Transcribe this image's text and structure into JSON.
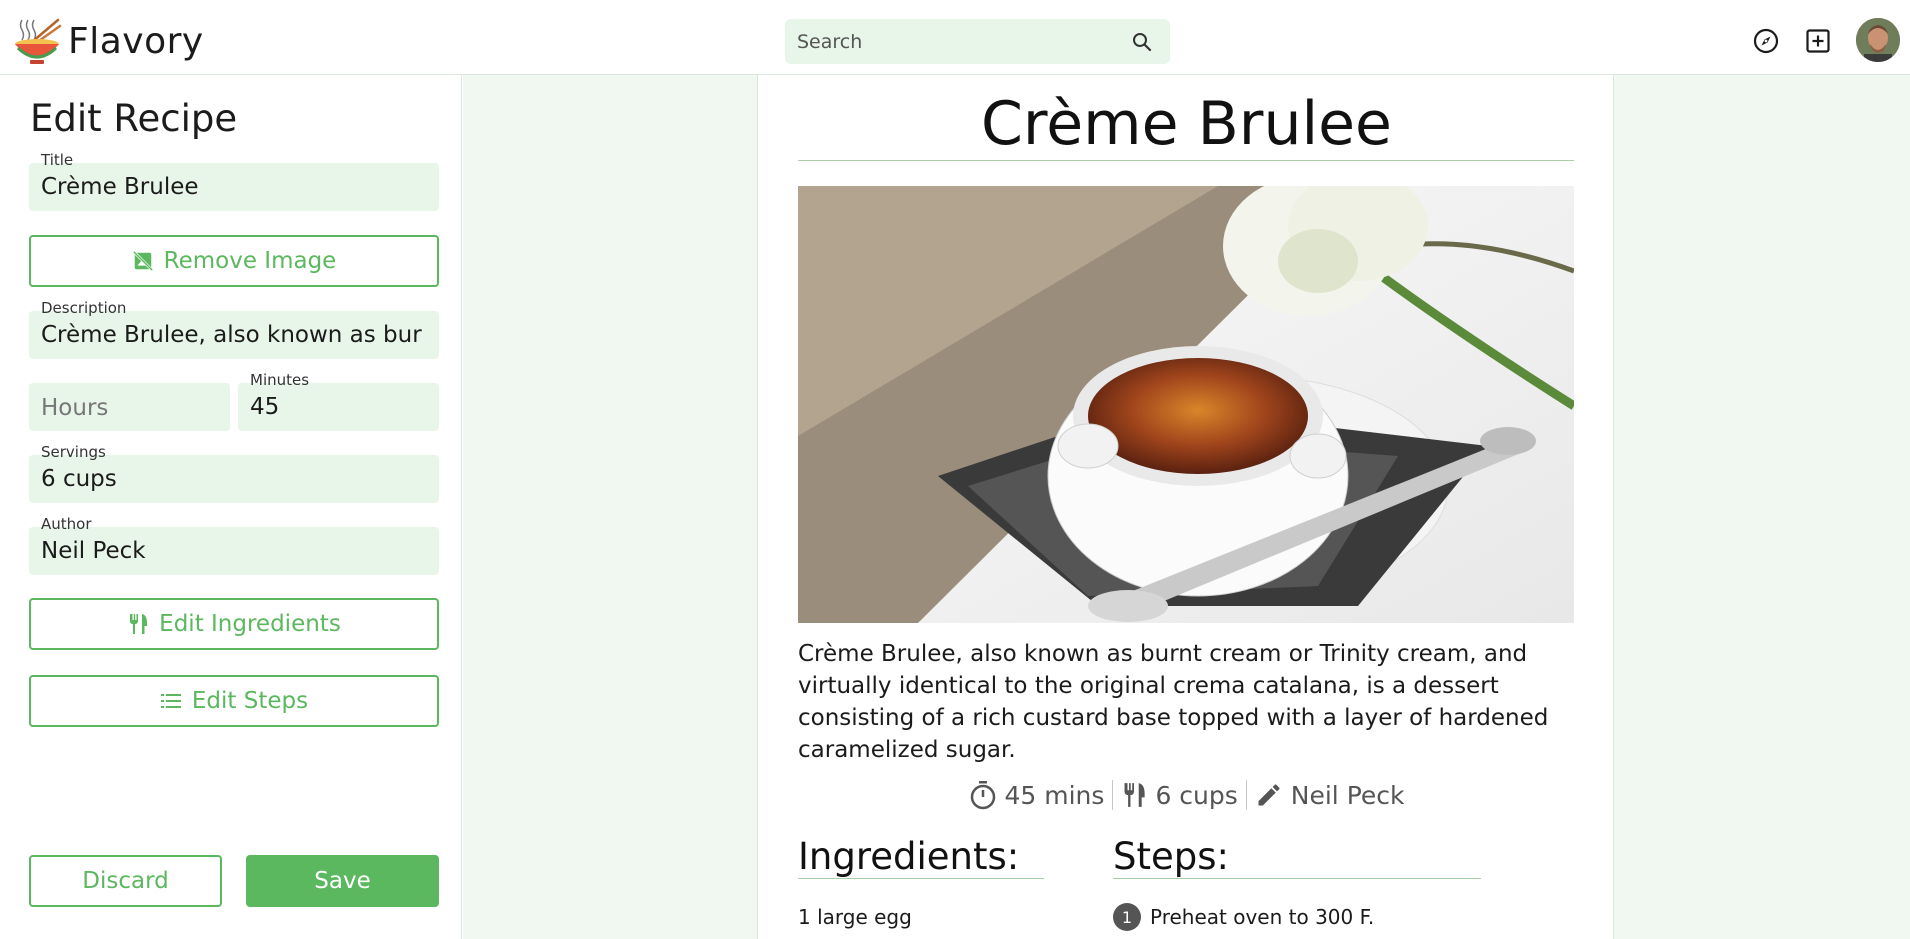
{
  "app": {
    "name": "Flavory",
    "logo": "noodle-bowl-logo"
  },
  "search": {
    "placeholder": "Search",
    "icon": "search-icon"
  },
  "header_icons": [
    "compass-icon",
    "add-box-icon",
    "user-avatar"
  ],
  "editor": {
    "title": "Edit Recipe",
    "fields": {
      "title": {
        "label": "Title",
        "value": "Crème Brulee"
      },
      "description": {
        "label": "Description",
        "value": "Crème Brulee, also known as bur"
      },
      "hours": {
        "placeholder": "Hours"
      },
      "minutes": {
        "label": "Minutes",
        "value": "45"
      },
      "servings": {
        "label": "Servings",
        "value": "6 cups"
      },
      "author": {
        "label": "Author",
        "value": "Neil Peck"
      }
    },
    "buttons": {
      "remove_image": "Remove Image",
      "edit_ingredients": "Edit Ingredients",
      "edit_steps": "Edit Steps",
      "discard": "Discard",
      "save": "Save"
    }
  },
  "preview": {
    "title": "Crème Brulee",
    "description": "Crème Brulee, also known as burnt cream or Trinity cream, and virtually identical to the original crema catalana, is a dessert consisting of a rich custard base topped with a layer of hardened caramelized sugar.",
    "meta": {
      "time": "45 mins",
      "servings": "6 cups",
      "author": "Neil Peck"
    },
    "ingredients_title": "Ingredients:",
    "steps_title": "Steps:",
    "ingredients": [
      "1 large egg"
    ],
    "steps": [
      {
        "number": "1",
        "text": "Preheat oven to 300 F."
      }
    ]
  },
  "colors": {
    "accent": "#5cb85f",
    "field_bg": "#e8f5e9",
    "preview_bg": "#f1f8f1"
  }
}
